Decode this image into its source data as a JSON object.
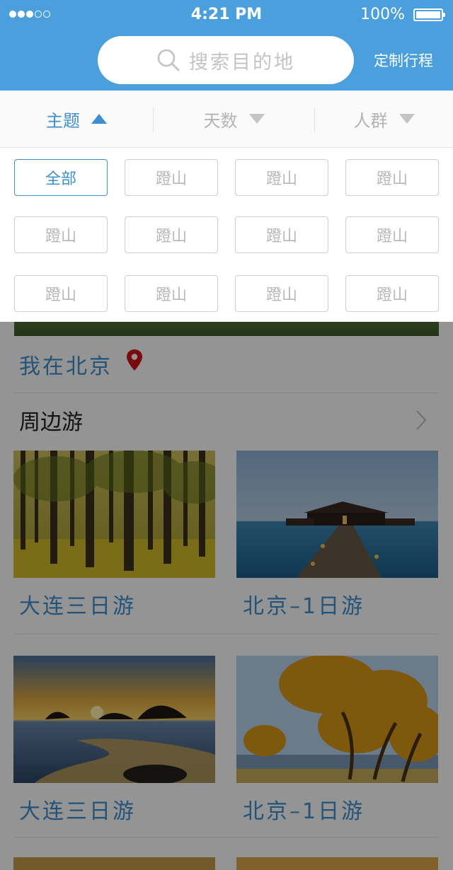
{
  "status_bar": {
    "time": "4:21 PM",
    "battery": "100%"
  },
  "search": {
    "placeholder": "搜索目的地"
  },
  "header": {
    "custom_trip": "定制行程"
  },
  "filters": {
    "theme": "主题",
    "days": "天数",
    "crowd": "人群"
  },
  "theme_options": [
    "全部",
    "蹬山",
    "蹬山",
    "蹬山",
    "蹬山",
    "蹬山",
    "蹬山",
    "蹬山",
    "蹬山",
    "蹬山",
    "蹬山",
    "蹬山"
  ],
  "location": {
    "label": "我在北京"
  },
  "nearby": {
    "title": "周边游",
    "cards": [
      {
        "title": "大连三日游",
        "image": "ginkgo-forest"
      },
      {
        "title": "北京–1日游",
        "image": "overwater-villa"
      },
      {
        "title": "大连三日游",
        "image": "sunset-beach"
      },
      {
        "title": "北京–1日游",
        "image": "golden-poplars"
      }
    ]
  },
  "colors": {
    "header_blue": "#4a9fdc",
    "accent_blue": "#3e8fcf",
    "pin_red": "#d0121b"
  }
}
